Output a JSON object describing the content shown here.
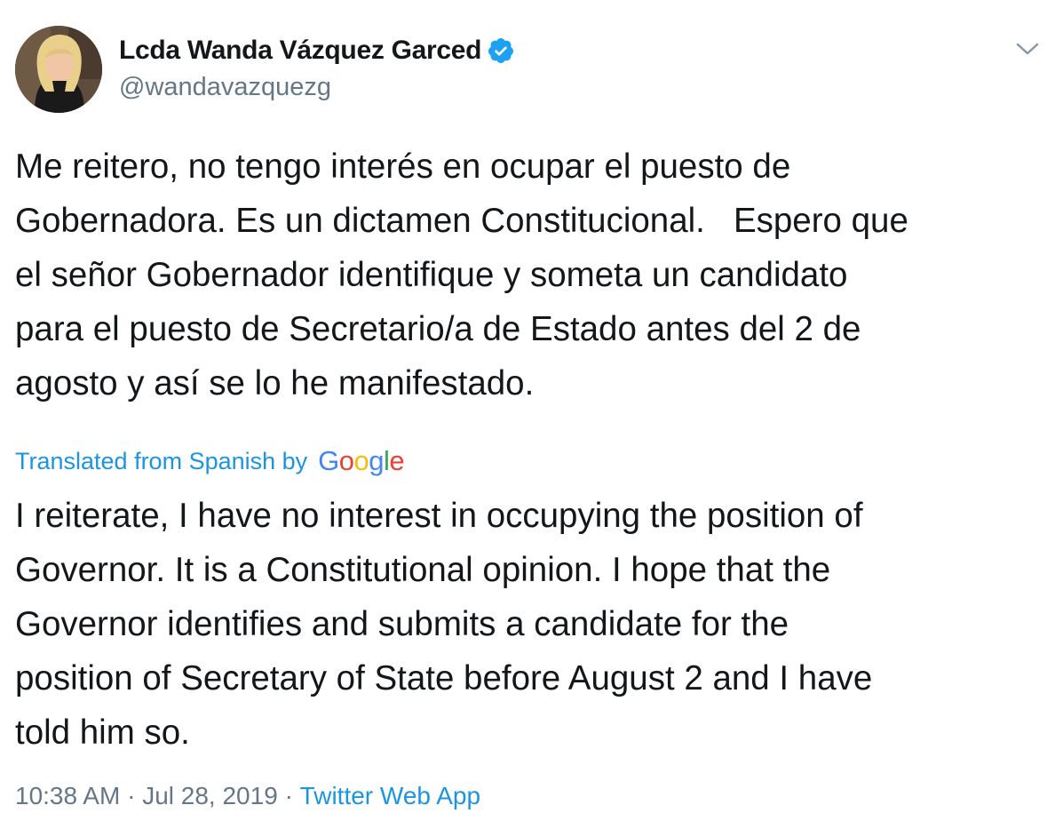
{
  "user": {
    "display_name": "Lcda Wanda Vázquez Garced",
    "handle": "@wandavazquezg",
    "verified": true,
    "avatar_icon": "profile-photo"
  },
  "tweet": {
    "original_text": "Me reitero, no tengo interés en ocupar el puesto de\nGobernadora. Es un dictamen Constitucional.   Espero que\nel señor Gobernador identifique y someta un candidato\npara el puesto de Secretario/a de Estado antes del 2 de\nagosto y así se lo he manifestado.",
    "translation_label": "Translated from Spanish by",
    "translation_provider": "Google",
    "translated_text": "I reiterate, I have no interest in occupying the position of\nGovernor. It is a Constitutional opinion. I hope that the\nGovernor identifies and submits a candidate for the\nposition of Secretary of State before August 2 and I have\ntold him so.",
    "time": "10:38 AM",
    "date": "Jul 28, 2019",
    "source": "Twitter Web App",
    "separator": "·"
  },
  "icons": {
    "verified": "verified-badge-icon",
    "menu": "chevron-down-icon"
  },
  "colors": {
    "link_blue": "#1b95e0",
    "verified_blue": "#1da1f2",
    "secondary_gray": "#657786",
    "text": "#14171a",
    "google_blue": "#4285F4",
    "google_red": "#EA4335",
    "google_yellow": "#FBBC05",
    "google_green": "#34A853"
  }
}
